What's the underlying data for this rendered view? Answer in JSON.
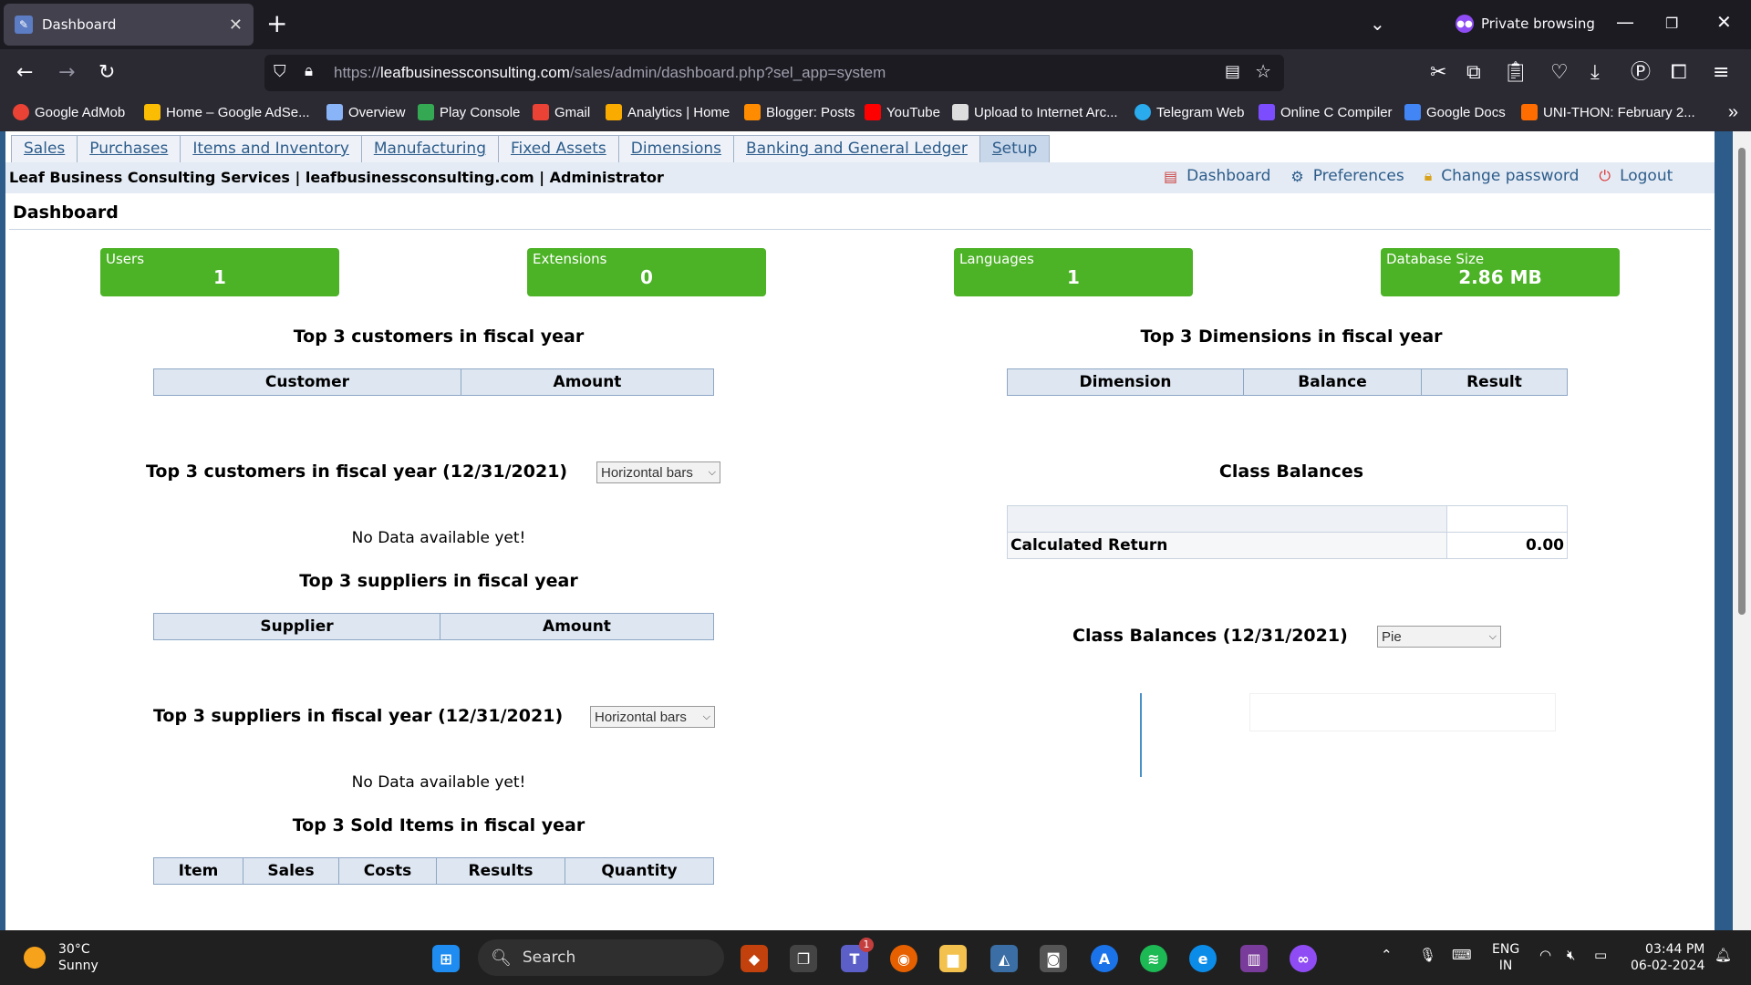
{
  "browser": {
    "tab_title": "Dashboard",
    "private_label": "Private browsing",
    "url_domain": "leafbusinessconsulting.com",
    "url_prefix": "https://",
    "url_path": "/sales/admin/dashboard.php?sel_app=system",
    "bookmarks": [
      {
        "label": "Google AdMob",
        "color": "#ea4335"
      },
      {
        "label": "Home – Google AdSe...",
        "color": "#fbbc04"
      },
      {
        "label": "Overview",
        "color": "#8ab4f8"
      },
      {
        "label": "Play Console",
        "color": "#34a853"
      },
      {
        "label": "Gmail",
        "color": "#ea4335"
      },
      {
        "label": "Analytics | Home",
        "color": "#f9ab00"
      },
      {
        "label": "Blogger: Posts",
        "color": "#ff8c00"
      },
      {
        "label": "YouTube",
        "color": "#ff0000"
      },
      {
        "label": "Upload to Internet Arc...",
        "color": "#dddddd"
      },
      {
        "label": "Telegram Web",
        "color": "#2aabee"
      },
      {
        "label": "Online C Compiler",
        "color": "#7b4dff"
      },
      {
        "label": "Google Docs",
        "color": "#4285f4"
      },
      {
        "label": "UNI-THON: February 2...",
        "color": "#ff6d00"
      }
    ]
  },
  "app": {
    "menu": [
      "Sales",
      "Purchases",
      "Items and Inventory",
      "Manufacturing",
      "Fixed Assets",
      "Dimensions",
      "Banking and General Ledger",
      "Setup"
    ],
    "company_line": "Leaf Business Consulting Services | leafbusinessconsulting.com | Administrator",
    "links": {
      "dashboard": "Dashboard",
      "preferences": "Preferences",
      "change_password": "Change password",
      "logout": "Logout"
    },
    "page_title": "Dashboard"
  },
  "stats": [
    {
      "label": "Users",
      "value": "1"
    },
    {
      "label": "Extensions",
      "value": "0"
    },
    {
      "label": "Languages",
      "value": "1"
    },
    {
      "label": "Database Size",
      "value": "2.86 MB"
    }
  ],
  "left": {
    "top_customers_title": "Top 3 customers in fiscal year",
    "top_customers_headers": [
      "Customer",
      "Amount"
    ],
    "top_customers_chart_title": "Top 3 customers in fiscal year (12/31/2021)",
    "chart_type_select": "Horizontal bars",
    "no_data": "No Data available yet!",
    "top_suppliers_title": "Top 3 suppliers in fiscal year",
    "top_suppliers_headers": [
      "Supplier",
      "Amount"
    ],
    "top_suppliers_chart_title": "Top 3 suppliers in fiscal year (12/31/2021)",
    "top_sold_title": "Top 3 Sold Items in fiscal year",
    "top_sold_headers": [
      "Item",
      "Sales",
      "Costs",
      "Results",
      "Quantity"
    ]
  },
  "right": {
    "top_dimensions_title": "Top 3 Dimensions in fiscal year",
    "top_dimensions_headers": [
      "Dimension",
      "Balance",
      "Result"
    ],
    "class_balances_title": "Class Balances",
    "calculated_return_label": "Calculated Return",
    "calculated_return_value": "0.00",
    "class_balances_chart_title": "Class Balances (12/31/2021)",
    "pie_select": "Pie"
  },
  "taskbar": {
    "temperature": "30°C",
    "condition": "Sunny",
    "search": "Search",
    "lang_1": "ENG",
    "lang_2": "IN",
    "time": "03:44 PM",
    "date": "06-02-2024",
    "teams_badge": "1"
  }
}
